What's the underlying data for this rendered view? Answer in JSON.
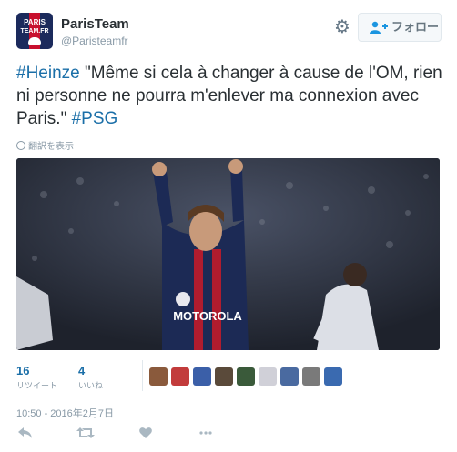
{
  "header": {
    "display_name": "ParisTeam",
    "handle": "@Paristeamfr",
    "avatar_text_top": "PARIS",
    "avatar_text_bottom": "TEAM.FR",
    "follow_label": "フォロー",
    "settings_icon": "gear-icon",
    "follow_icon": "add-user-icon"
  },
  "tweet": {
    "hashtag_1": "#Heinze",
    "body": " \"Même si cela à changer à cause de l'OM, rien ni personne ne pourra m'enlever ma connexion avec Paris.\" ",
    "hashtag_2": "#PSG",
    "translate_label": "翻訳を表示"
  },
  "photo": {
    "jersey_text": "MOTOROLA"
  },
  "stats": {
    "retweets_count": "16",
    "retweets_label": "リツイート",
    "likes_count": "4",
    "likes_label": "いいね",
    "liker_colors": [
      "#8a5a3c",
      "#c23b3b",
      "#3b5fa8",
      "#5a4a3a",
      "#3a5a3a",
      "#d0d0d8",
      "#4a6aa0",
      "#7a7a7a",
      "#3a6ab0"
    ]
  },
  "timestamp": "10:50 - 2016年2月7日",
  "actions": {
    "reply_icon": "reply-icon",
    "retweet_icon": "retweet-icon",
    "like_icon": "heart-icon",
    "more_icon": "more-icon"
  },
  "colors": {
    "link": "#1b6fa8",
    "muted": "#8899a6",
    "border": "#e1e8ed"
  }
}
